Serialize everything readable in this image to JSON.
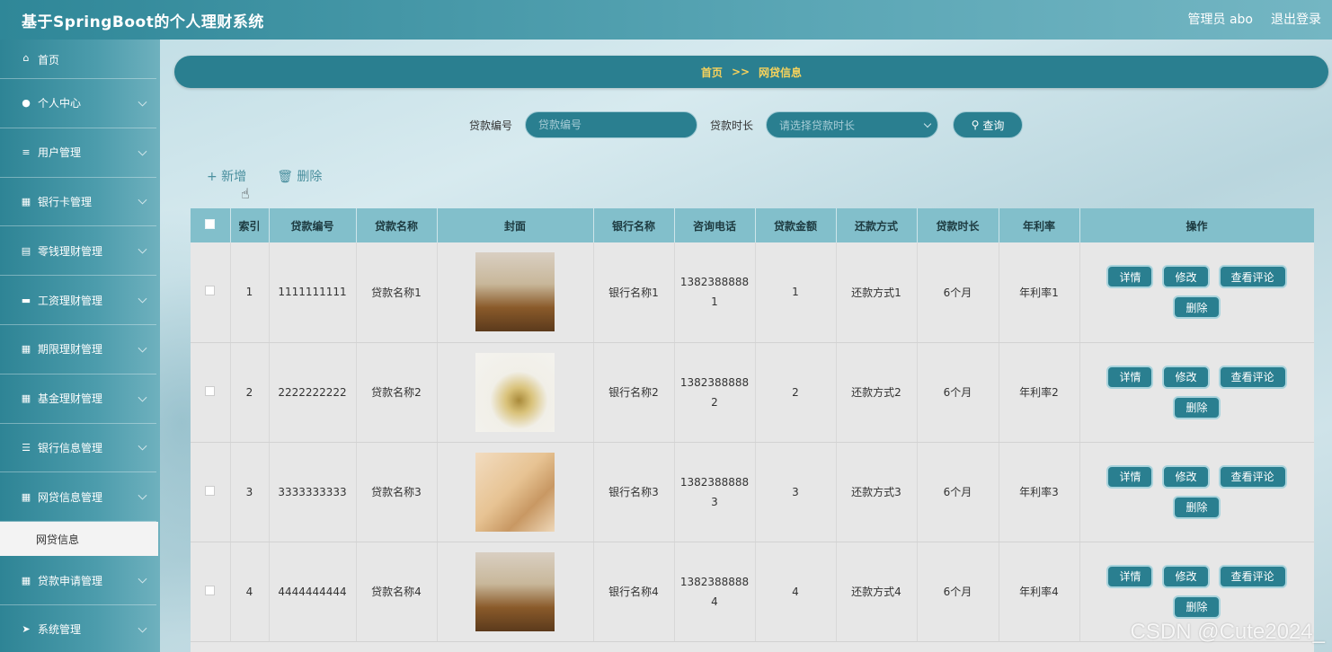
{
  "app": {
    "title": "基于SpringBoot的个人理财系统"
  },
  "header": {
    "admin": "管理员 abo",
    "logout": "退出登录"
  },
  "sidebar": {
    "items": [
      {
        "label": "首页",
        "icon": "home-icon"
      },
      {
        "label": "个人中心",
        "icon": "user-icon"
      },
      {
        "label": "用户管理",
        "icon": "sliders-icon"
      },
      {
        "label": "银行卡管理",
        "icon": "grid-icon"
      },
      {
        "label": "零钱理财管理",
        "icon": "clipboard-icon"
      },
      {
        "label": "工资理财管理",
        "icon": "card-icon"
      },
      {
        "label": "期限理财管理",
        "icon": "grid-icon"
      },
      {
        "label": "基金理财管理",
        "icon": "grid-icon"
      },
      {
        "label": "银行信息管理",
        "icon": "list-icon"
      },
      {
        "label": "网贷信息管理",
        "icon": "grid-icon"
      },
      {
        "label": "网贷信息",
        "sub": true
      },
      {
        "label": "贷款申请管理",
        "icon": "grid-icon"
      },
      {
        "label": "系统管理",
        "icon": "send-icon"
      }
    ]
  },
  "breadcrumb": {
    "home": "首页",
    "sep": ">>",
    "current": "网贷信息"
  },
  "search": {
    "loan_no_label": "贷款编号",
    "loan_no_placeholder": "贷款编号",
    "duration_label": "贷款时长",
    "duration_placeholder": "请选择贷款时长",
    "query": "查询"
  },
  "actions": {
    "add": "+ 新增",
    "delete": "删除"
  },
  "table": {
    "columns": [
      "索引",
      "贷款编号",
      "贷款名称",
      "封面",
      "银行名称",
      "咨询电话",
      "贷款金额",
      "还款方式",
      "贷款时长",
      "年利率",
      "操作"
    ],
    "rows": [
      {
        "index": "1",
        "loan_no": "1111111111",
        "name": "贷款名称1",
        "cover": "cover1",
        "bank": "银行名称1",
        "phone_a": "1382388888",
        "phone_b": "1",
        "amount": "1",
        "repay": "还款方式1",
        "duration": "6个月",
        "rate": "年利率1"
      },
      {
        "index": "2",
        "loan_no": "2222222222",
        "name": "贷款名称2",
        "cover": "cover2",
        "bank": "银行名称2",
        "phone_a": "1382388888",
        "phone_b": "2",
        "amount": "2",
        "repay": "还款方式2",
        "duration": "6个月",
        "rate": "年利率2"
      },
      {
        "index": "3",
        "loan_no": "3333333333",
        "name": "贷款名称3",
        "cover": "cover3",
        "bank": "银行名称3",
        "phone_a": "1382388888",
        "phone_b": "3",
        "amount": "3",
        "repay": "还款方式3",
        "duration": "6个月",
        "rate": "年利率3"
      },
      {
        "index": "4",
        "loan_no": "4444444444",
        "name": "贷款名称4",
        "cover": "cover1",
        "bank": "银行名称4",
        "phone_a": "1382388888",
        "phone_b": "4",
        "amount": "4",
        "repay": "还款方式4",
        "duration": "6个月",
        "rate": "年利率4"
      }
    ],
    "ops": {
      "detail": "详情",
      "edit": "修改",
      "comments": "查看评论",
      "delete": "删除"
    }
  },
  "watermark": "CSDN @Cute2024_",
  "colors": {
    "primary": "#2a7f90",
    "header": "#2f8798",
    "crumb_text": "#f6d25c",
    "table_head": "#82bfcb"
  }
}
